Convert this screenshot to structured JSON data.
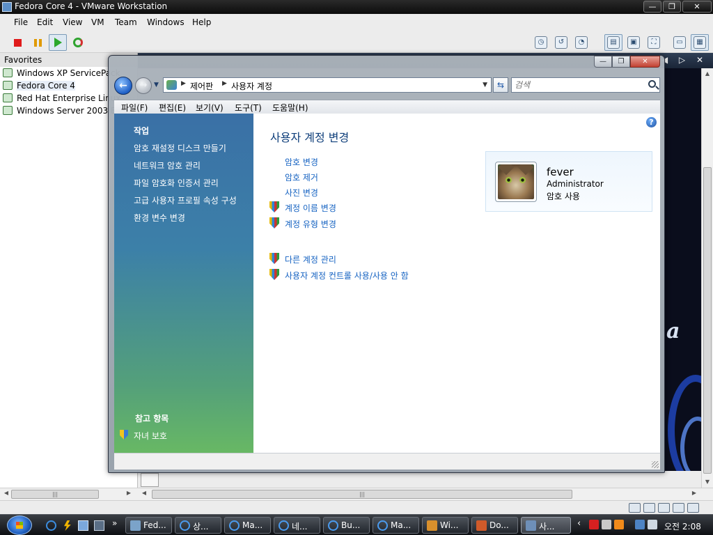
{
  "host": {
    "title": "Fedora Core 4 - VMware Workstation",
    "window_buttons": [
      "—",
      "❐",
      "✕"
    ],
    "menu": [
      "File",
      "Edit",
      "View",
      "VM",
      "Team",
      "Windows",
      "Help"
    ],
    "toolbar_right_icons": [
      "snapshot-icon",
      "revert-icon",
      "snapshot-manager-icon",
      "sidebar-toggle-icon",
      "quick-switch-icon",
      "full-screen-icon",
      "summary-icon",
      "console-icon"
    ]
  },
  "favorites": {
    "header": "Favorites",
    "items": [
      {
        "label": "Windows XP ServicePack"
      },
      {
        "label": "Fedora Core 4"
      },
      {
        "label": "Red Hat Enterprise Linux"
      },
      {
        "label": "Windows Server 2003 Ent"
      }
    ]
  },
  "guest_top_nav": "◀ ▷ ✕",
  "control_panel": {
    "window_buttons": {
      "min": "—",
      "max": "❐",
      "close": "✕"
    },
    "address": {
      "crumbs": [
        "제어판",
        "사용자 계정"
      ]
    },
    "search_placeholder": "검색",
    "menu": [
      "파일(F)",
      "편집(E)",
      "보기(V)",
      "도구(T)",
      "도움말(H)"
    ],
    "tasks": {
      "title": "작업",
      "links": [
        "암호 재설정 디스크 만들기",
        "네트워크 암호 관리",
        "파일 암호화 인증서 관리",
        "고급 사용자 프로필 속성 구성",
        "환경 변수 변경"
      ]
    },
    "see_also": {
      "title": "참고 항목",
      "link": "자녀 보호"
    },
    "main": {
      "heading": "사용자 계정 변경",
      "links": [
        {
          "label": "암호 변경",
          "shield": false
        },
        {
          "label": "암호 제거",
          "shield": false
        },
        {
          "label": "사진 변경",
          "shield": false
        },
        {
          "label": "계정 이름 변경",
          "shield": true
        },
        {
          "label": "계정 유형 변경",
          "shield": true
        }
      ],
      "links2": [
        {
          "label": "다른 계정 관리",
          "shield": true
        },
        {
          "label": "사용자 계정 컨트롤 사용/사용 안 함",
          "shield": true
        }
      ]
    },
    "user": {
      "name": "fever",
      "role": "Administrator",
      "password_status": "암호 사용"
    }
  },
  "taskbar": {
    "buttons": [
      {
        "label": "Fed...",
        "icon": "vm"
      },
      {
        "label": "상...",
        "icon": "ie"
      },
      {
        "label": "Ma...",
        "icon": "ie"
      },
      {
        "label": "네...",
        "icon": "ie"
      },
      {
        "label": "Bu...",
        "icon": "ie"
      },
      {
        "label": "Ma...",
        "icon": "ie"
      },
      {
        "label": "Wi...",
        "icon": "media"
      },
      {
        "label": "Do...",
        "icon": "camera"
      },
      {
        "label": "사...",
        "icon": "users",
        "active": true
      }
    ],
    "clock": "오전 2:08"
  },
  "colors": {
    "link_blue": "#1663c2",
    "heading_blue": "#0e3e7a",
    "task_pane_top": "#3a70a6",
    "task_pane_bottom": "#68b864"
  }
}
